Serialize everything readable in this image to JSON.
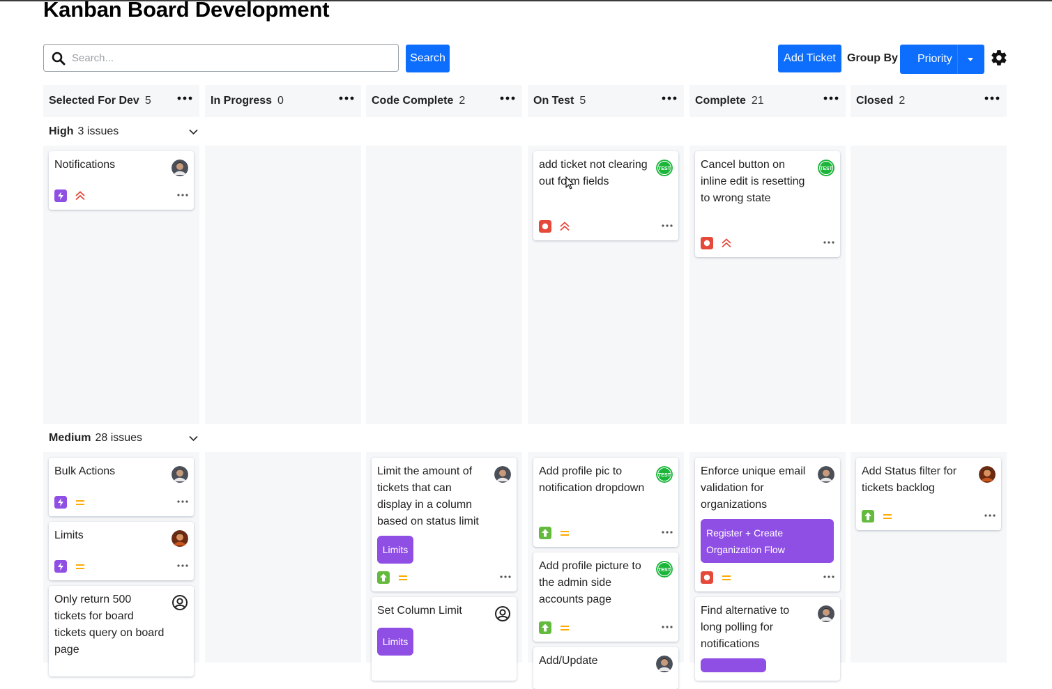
{
  "page": {
    "title": "Kanban Board Development"
  },
  "toolbar": {
    "search_placeholder": "Search...",
    "search_label": "Search",
    "add_label": "Add Ticket",
    "group_by_label": "Group By",
    "group_by_value": "Priority"
  },
  "columns": [
    {
      "name": "Selected For Dev",
      "count": "5"
    },
    {
      "name": "In Progress",
      "count": "0"
    },
    {
      "name": "Code Complete",
      "count": "2"
    },
    {
      "name": "On Test",
      "count": "5"
    },
    {
      "name": "Complete",
      "count": "21"
    },
    {
      "name": "Closed",
      "count": "2"
    }
  ],
  "swimlanes": {
    "high": {
      "label": "High",
      "count": "3 issues"
    },
    "medium": {
      "label": "Medium",
      "count": "28 issues"
    }
  },
  "cards": {
    "notifications": "Notifications",
    "add_ticket_not_clearing": "add ticket not clearing out form fields",
    "cancel_button": "Cancel button on inline edit is resetting to wrong state",
    "bulk_actions": "Bulk Actions",
    "limits": "Limits",
    "only_return_500": "Only return 500 tickets for board tickets query on board page",
    "limit_amount": "Limit the amount of tickets that can display in a column based on status limit",
    "set_column_limit": "Set Column Limit",
    "profile_pic_dropdown": "Add profile pic to notification dropdown",
    "profile_picture_admin": "Add profile picture to the admin side accounts page",
    "add_update": "Add/Update",
    "enforce_unique_email": "Enforce unique email validation for organizations",
    "find_alternative": "Find alternative to long polling for notifications",
    "status_filter": "Add Status filter for tickets backlog"
  },
  "tags": {
    "limits": "Limits",
    "register_org": "Register + Create Organization Flow"
  },
  "colors": {
    "primary": "#0d6efd",
    "epic_purple": "#8f4ee4",
    "bug_red": "#e5493a",
    "story_green": "#63ba3c",
    "priority_high": "#e5493a",
    "priority_medium": "#ffab00",
    "test_badge": "#1bb53a"
  },
  "icons": {
    "search": "search-icon",
    "gear": "gear-icon",
    "more": "more-horizontal-icon",
    "chevron": "chevron-down-icon",
    "epic": "lightning-icon",
    "bug": "bug-icon",
    "story": "arrow-up-icon",
    "high_priority": "double-chevron-up-icon",
    "medium_priority": "equals-icon",
    "unassigned": "user-circle-icon",
    "test_badge": "test-badge-icon"
  }
}
